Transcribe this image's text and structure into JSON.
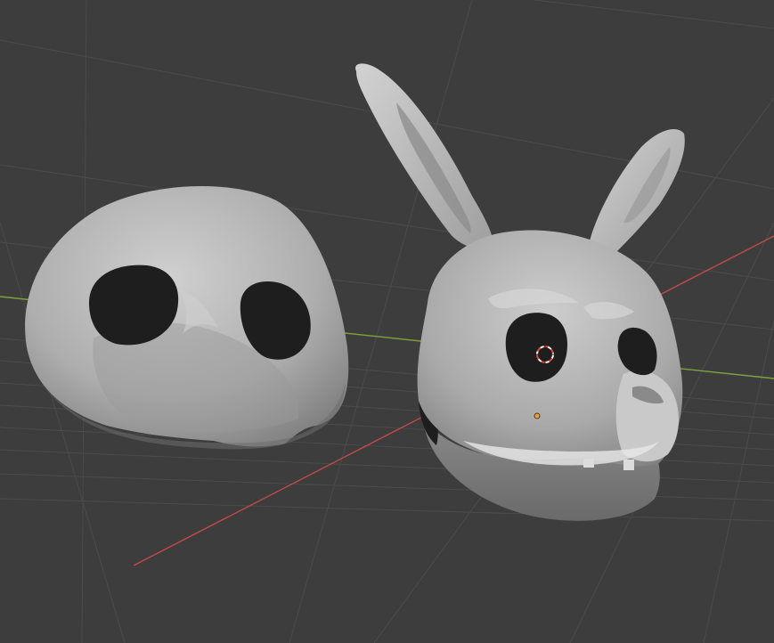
{
  "viewport": {
    "mode": "solid",
    "background_color": "#3d3d3d"
  },
  "axes": {
    "x_axis_color": "#c4494d",
    "y_axis_color": "#7fa33a",
    "grid_color": "#4a4a4a"
  },
  "objects": [
    {
      "kind": "mask",
      "shape": "half-skull mask",
      "color": "#b8b8b8"
    },
    {
      "kind": "mask",
      "shape": "rabbit skull head with ears",
      "color": "#b8b8b8"
    }
  ],
  "overlays": {
    "cursor_3d_color": "#d94a3a",
    "origin_dot_color": "#f0a030"
  }
}
